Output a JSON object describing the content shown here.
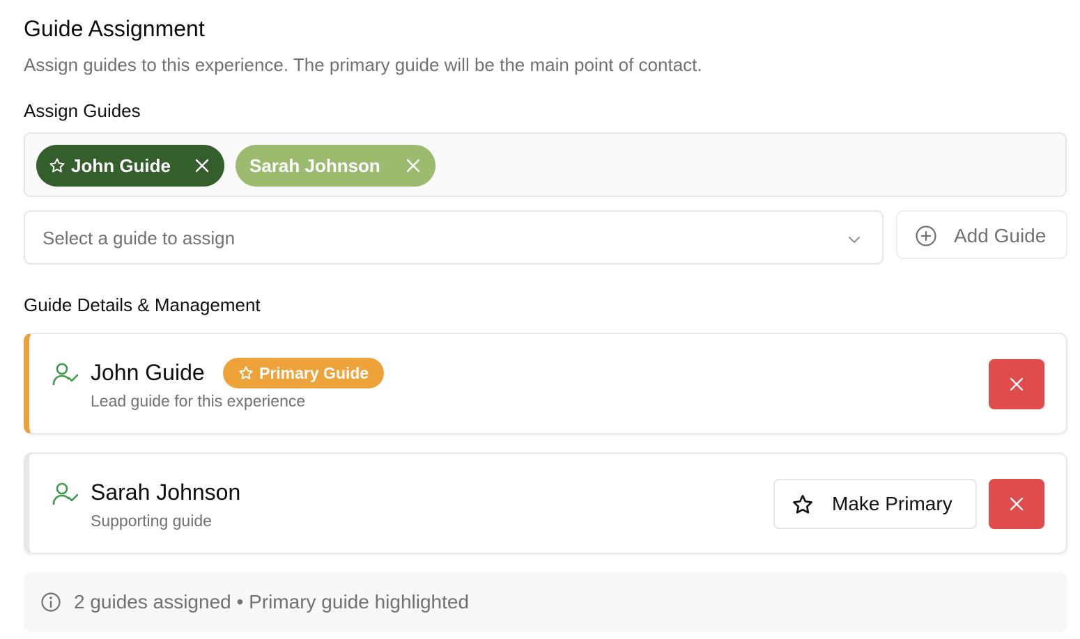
{
  "header": {
    "title": "Guide Assignment",
    "subtitle": "Assign guides to this experience. The primary guide will be the main point of contact."
  },
  "assign": {
    "label": "Assign Guides",
    "chips": [
      {
        "name": "John Guide",
        "primary": true,
        "icon": "star-icon"
      },
      {
        "name": "Sarah Johnson",
        "primary": false
      }
    ],
    "select_placeholder": "Select a guide to assign",
    "add_label": "Add Guide"
  },
  "details": {
    "label": "Guide Details & Management",
    "guides": [
      {
        "name": "John Guide",
        "badge": "Primary Guide",
        "description": "Lead guide for this experience",
        "icon": "user-check-icon"
      },
      {
        "name": "Sarah Johnson",
        "description": "Supporting guide",
        "make_primary_label": "Make Primary",
        "icon": "user-check-icon"
      }
    ]
  },
  "footer": {
    "text": "2 guides assigned • Primary guide highlighted",
    "icon": "info-icon"
  },
  "colors": {
    "primary_chip": "#355e2d",
    "secondary_chip": "#9dbb6f",
    "badge": "#eda33a",
    "delete": "#e04b4b",
    "user_icon": "#3d9a4b"
  }
}
